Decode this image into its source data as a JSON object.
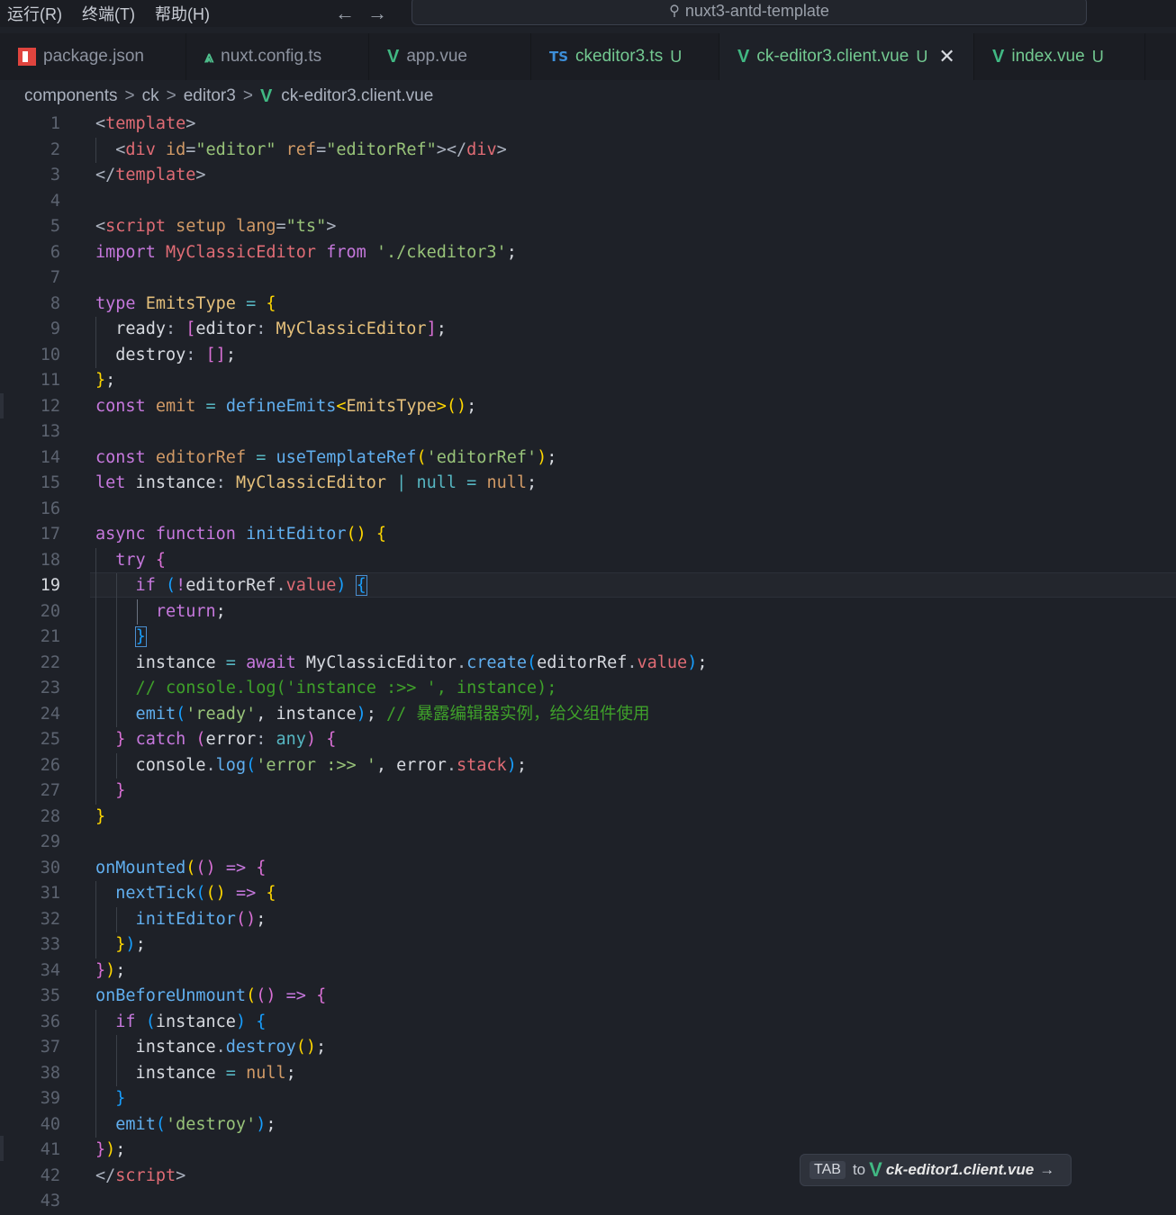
{
  "menu": [
    "运行(R)",
    "终端(T)",
    "帮助(H)"
  ],
  "search": {
    "text": "nuxt3-antd-template"
  },
  "tabs": [
    {
      "label": "package.json",
      "icon": "npm-icon",
      "mod": "",
      "width": 207
    },
    {
      "label": "nuxt.config.ts",
      "icon": "nuxt-icon",
      "mod": "",
      "width": 203
    },
    {
      "label": "app.vue",
      "icon": "vue-icon",
      "mod": "",
      "width": 180
    },
    {
      "label": "ckeditor3.ts",
      "icon": "ts-icon",
      "mod": "U",
      "width": 209
    },
    {
      "label": "ck-editor3.client.vue",
      "icon": "vue-icon",
      "mod": "U",
      "width": 283,
      "active": true,
      "close": "✕"
    },
    {
      "label": "index.vue",
      "icon": "vue-icon",
      "mod": "U",
      "width": 190
    }
  ],
  "breadcrumb": [
    "components",
    "ck",
    "editor3",
    "ck-editor3.client.vue"
  ],
  "current_line": 19,
  "lines": [
    [
      [
        "t-punc",
        "<"
      ],
      [
        "t-tag",
        "template"
      ],
      [
        "t-punc",
        ">"
      ]
    ],
    [
      [
        "t-punc",
        "  <"
      ],
      [
        "t-tag",
        "div"
      ],
      [
        "t-punc",
        " "
      ],
      [
        "t-attr",
        "id"
      ],
      [
        "t-punc",
        "="
      ],
      [
        "t-str",
        "\"editor\""
      ],
      [
        "t-punc",
        " "
      ],
      [
        "t-attr",
        "ref"
      ],
      [
        "t-punc",
        "="
      ],
      [
        "t-str",
        "\"editorRef\""
      ],
      [
        "t-punc",
        "></"
      ],
      [
        "t-tag",
        "div"
      ],
      [
        "t-punc",
        ">"
      ]
    ],
    [
      [
        "t-punc",
        "</"
      ],
      [
        "t-tag",
        "template"
      ],
      [
        "t-punc",
        ">"
      ]
    ],
    [],
    [
      [
        "t-punc",
        "<"
      ],
      [
        "t-tag",
        "script"
      ],
      [
        "t-punc",
        " "
      ],
      [
        "t-attr",
        "setup"
      ],
      [
        "t-punc",
        " "
      ],
      [
        "t-attr",
        "lang"
      ],
      [
        "t-punc",
        "="
      ],
      [
        "t-str",
        "\"ts\""
      ],
      [
        "t-punc",
        ">"
      ]
    ],
    [
      [
        "t-kw",
        "import"
      ],
      [
        "t-plain",
        " "
      ],
      [
        "t-var",
        "MyClassicEditor"
      ],
      [
        "t-plain",
        " "
      ],
      [
        "t-kw",
        "from"
      ],
      [
        "t-plain",
        " "
      ],
      [
        "t-str",
        "'./ckeditor3'"
      ],
      [
        "t-plain",
        ";"
      ]
    ],
    [],
    [
      [
        "t-kw",
        "type"
      ],
      [
        "t-plain",
        " "
      ],
      [
        "t-cls",
        "EmitsType"
      ],
      [
        "t-plain",
        " "
      ],
      [
        "t-type",
        "="
      ],
      [
        "t-plain",
        " "
      ],
      [
        "t-b1",
        "{"
      ]
    ],
    [
      [
        "t-plain",
        "  ready"
      ],
      [
        "t-punc",
        ":"
      ],
      [
        "t-plain",
        " "
      ],
      [
        "t-b2",
        "["
      ],
      [
        "t-plain",
        "editor"
      ],
      [
        "t-punc",
        ":"
      ],
      [
        "t-plain",
        " "
      ],
      [
        "t-cls",
        "MyClassicEditor"
      ],
      [
        "t-b2",
        "]"
      ],
      [
        "t-plain",
        ";"
      ]
    ],
    [
      [
        "t-plain",
        "  destroy"
      ],
      [
        "t-punc",
        ":"
      ],
      [
        "t-plain",
        " "
      ],
      [
        "t-b2",
        "[]"
      ],
      [
        "t-plain",
        ";"
      ]
    ],
    [
      [
        "t-b1",
        "}"
      ],
      [
        "t-plain",
        ";"
      ]
    ],
    [
      [
        "t-kw",
        "const"
      ],
      [
        "t-plain",
        " "
      ],
      [
        "t-attr",
        "emit"
      ],
      [
        "t-plain",
        " "
      ],
      [
        "t-type",
        "="
      ],
      [
        "t-plain",
        " "
      ],
      [
        "t-fn",
        "defineEmits"
      ],
      [
        "t-b1",
        "<"
      ],
      [
        "t-cls",
        "EmitsType"
      ],
      [
        "t-b1",
        ">"
      ],
      [
        "t-b1",
        "()"
      ],
      [
        "t-plain",
        ";"
      ]
    ],
    [],
    [
      [
        "t-kw",
        "const"
      ],
      [
        "t-plain",
        " "
      ],
      [
        "t-attr",
        "editorRef"
      ],
      [
        "t-plain",
        " "
      ],
      [
        "t-type",
        "="
      ],
      [
        "t-plain",
        " "
      ],
      [
        "t-fn",
        "useTemplateRef"
      ],
      [
        "t-b1",
        "("
      ],
      [
        "t-str",
        "'editorRef'"
      ],
      [
        "t-b1",
        ")"
      ],
      [
        "t-plain",
        ";"
      ]
    ],
    [
      [
        "t-kw",
        "let"
      ],
      [
        "t-plain",
        " instance"
      ],
      [
        "t-punc",
        ":"
      ],
      [
        "t-plain",
        " "
      ],
      [
        "t-cls",
        "MyClassicEditor"
      ],
      [
        "t-plain",
        " "
      ],
      [
        "t-type",
        "|"
      ],
      [
        "t-plain",
        " "
      ],
      [
        "t-type",
        "null"
      ],
      [
        "t-plain",
        " "
      ],
      [
        "t-type",
        "="
      ],
      [
        "t-plain",
        " "
      ],
      [
        "t-attr",
        "null"
      ],
      [
        "t-plain",
        ";"
      ]
    ],
    [],
    [
      [
        "t-kw",
        "async"
      ],
      [
        "t-plain",
        " "
      ],
      [
        "t-kw",
        "function"
      ],
      [
        "t-plain",
        " "
      ],
      [
        "t-fn",
        "initEditor"
      ],
      [
        "t-b1",
        "()"
      ],
      [
        "t-plain",
        " "
      ],
      [
        "t-b1",
        "{"
      ]
    ],
    [
      [
        "t-kw",
        "  try"
      ],
      [
        "t-plain",
        " "
      ],
      [
        "t-b2",
        "{"
      ]
    ],
    [
      [
        "t-kw",
        "    if"
      ],
      [
        "t-plain",
        " "
      ],
      [
        "t-b3",
        "("
      ],
      [
        "t-kw",
        "!"
      ],
      [
        "t-plain",
        "editorRef"
      ],
      [
        "t-punc",
        "."
      ],
      [
        "t-prop",
        "value"
      ],
      [
        "t-b3",
        ")"
      ],
      [
        "t-plain",
        " "
      ],
      [
        "t-b3 cursor-box",
        "{"
      ]
    ],
    [
      [
        "t-kw",
        "      return"
      ],
      [
        "t-plain",
        ";"
      ]
    ],
    [
      [
        "t-plain",
        "    "
      ],
      [
        "t-b3 cursor-box",
        "}"
      ]
    ],
    [
      [
        "t-plain",
        "    instance "
      ],
      [
        "t-type",
        "="
      ],
      [
        "t-plain",
        " "
      ],
      [
        "t-kw",
        "await"
      ],
      [
        "t-plain",
        " MyClassicEditor"
      ],
      [
        "t-punc",
        "."
      ],
      [
        "t-fn",
        "create"
      ],
      [
        "t-b3",
        "("
      ],
      [
        "t-plain",
        "editorRef"
      ],
      [
        "t-punc",
        "."
      ],
      [
        "t-prop",
        "value"
      ],
      [
        "t-b3",
        ")"
      ],
      [
        "t-plain",
        ";"
      ]
    ],
    [
      [
        "t-com",
        "    // console.log('instance :>> ', instance);"
      ]
    ],
    [
      [
        "t-fn",
        "    emit"
      ],
      [
        "t-b3",
        "("
      ],
      [
        "t-str",
        "'ready'"
      ],
      [
        "t-plain",
        ", instance"
      ],
      [
        "t-b3",
        ")"
      ],
      [
        "t-plain",
        "; "
      ],
      [
        "t-com",
        "// 暴露编辑器实例，给父组件使用"
      ]
    ],
    [
      [
        "t-b2",
        "  }"
      ],
      [
        "t-plain",
        " "
      ],
      [
        "t-kw",
        "catch"
      ],
      [
        "t-plain",
        " "
      ],
      [
        "t-b2",
        "("
      ],
      [
        "t-plain",
        "error"
      ],
      [
        "t-punc",
        ":"
      ],
      [
        "t-plain",
        " "
      ],
      [
        "t-type",
        "any"
      ],
      [
        "t-b2",
        ")"
      ],
      [
        "t-plain",
        " "
      ],
      [
        "t-b2",
        "{"
      ]
    ],
    [
      [
        "t-plain",
        "    console"
      ],
      [
        "t-punc",
        "."
      ],
      [
        "t-fn",
        "log"
      ],
      [
        "t-b3",
        "("
      ],
      [
        "t-str",
        "'error :>> '"
      ],
      [
        "t-plain",
        ", error"
      ],
      [
        "t-punc",
        "."
      ],
      [
        "t-prop",
        "stack"
      ],
      [
        "t-b3",
        ")"
      ],
      [
        "t-plain",
        ";"
      ]
    ],
    [
      [
        "t-b2",
        "  }"
      ]
    ],
    [
      [
        "t-b1",
        "}"
      ]
    ],
    [],
    [
      [
        "t-fn",
        "onMounted"
      ],
      [
        "t-b1",
        "("
      ],
      [
        "t-b2",
        "()"
      ],
      [
        "t-plain",
        " "
      ],
      [
        "t-kw",
        "=>"
      ],
      [
        "t-plain",
        " "
      ],
      [
        "t-b2",
        "{"
      ]
    ],
    [
      [
        "t-fn",
        "  nextTick"
      ],
      [
        "t-b3",
        "("
      ],
      [
        "t-b1",
        "()"
      ],
      [
        "t-plain",
        " "
      ],
      [
        "t-kw",
        "=>"
      ],
      [
        "t-plain",
        " "
      ],
      [
        "t-b1",
        "{"
      ]
    ],
    [
      [
        "t-fn",
        "    initEditor"
      ],
      [
        "t-b2",
        "()"
      ],
      [
        "t-plain",
        ";"
      ]
    ],
    [
      [
        "t-b1",
        "  }"
      ],
      [
        "t-b3",
        ")"
      ],
      [
        "t-plain",
        ";"
      ]
    ],
    [
      [
        "t-b2",
        "}"
      ],
      [
        "t-b1",
        ")"
      ],
      [
        "t-plain",
        ";"
      ]
    ],
    [
      [
        "t-fn",
        "onBeforeUnmount"
      ],
      [
        "t-b1",
        "("
      ],
      [
        "t-b2",
        "()"
      ],
      [
        "t-plain",
        " "
      ],
      [
        "t-kw",
        "=>"
      ],
      [
        "t-plain",
        " "
      ],
      [
        "t-b2",
        "{"
      ]
    ],
    [
      [
        "t-kw",
        "  if"
      ],
      [
        "t-plain",
        " "
      ],
      [
        "t-b3",
        "("
      ],
      [
        "t-plain",
        "instance"
      ],
      [
        "t-b3",
        ")"
      ],
      [
        "t-plain",
        " "
      ],
      [
        "t-b3",
        "{"
      ]
    ],
    [
      [
        "t-plain",
        "    instance"
      ],
      [
        "t-punc",
        "."
      ],
      [
        "t-fn",
        "destroy"
      ],
      [
        "t-b1",
        "()"
      ],
      [
        "t-plain",
        ";"
      ]
    ],
    [
      [
        "t-plain",
        "    instance "
      ],
      [
        "t-type",
        "="
      ],
      [
        "t-plain",
        " "
      ],
      [
        "t-attr",
        "null"
      ],
      [
        "t-plain",
        ";"
      ]
    ],
    [
      [
        "t-b3",
        "  }"
      ]
    ],
    [
      [
        "t-fn",
        "  emit"
      ],
      [
        "t-b3",
        "("
      ],
      [
        "t-str",
        "'destroy'"
      ],
      [
        "t-b3",
        ")"
      ],
      [
        "t-plain",
        ";"
      ]
    ],
    [
      [
        "t-b2",
        "}"
      ],
      [
        "t-b1",
        ")"
      ],
      [
        "t-plain",
        ";"
      ]
    ],
    [
      [
        "t-punc",
        "</"
      ],
      [
        "t-tag",
        "script"
      ],
      [
        "t-punc",
        ">"
      ]
    ],
    []
  ],
  "tab_hint": {
    "key": "TAB",
    "to": "to",
    "file": "ck-editor1.client.vue",
    "arrow": "→"
  }
}
